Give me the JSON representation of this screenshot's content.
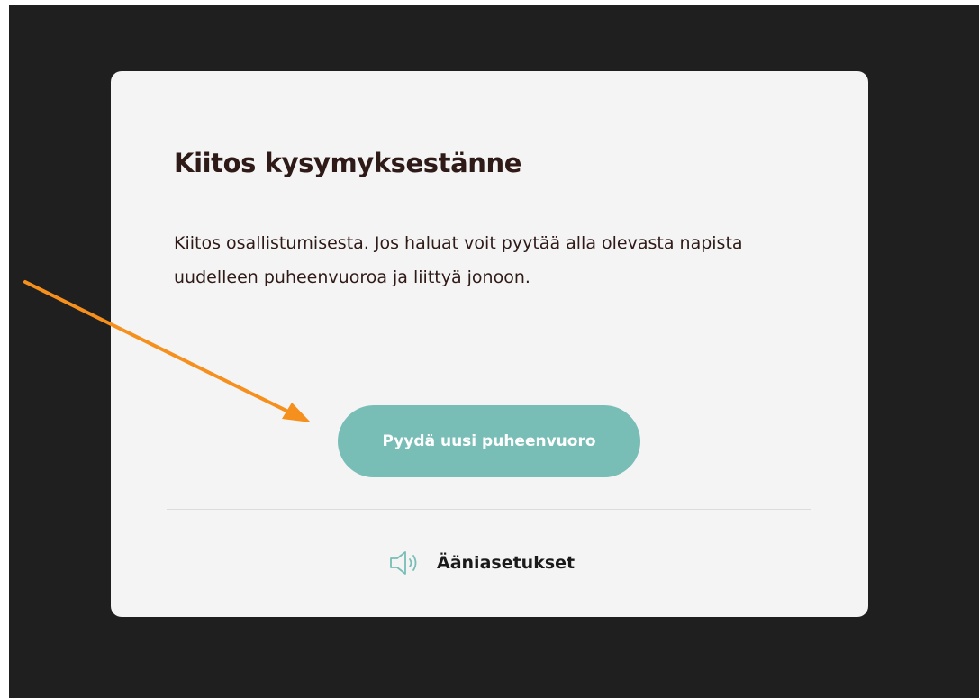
{
  "dialog": {
    "title": "Kiitos kysymyksestänne",
    "body": "Kiitos osallistumisesta. Jos haluat voit pyytää alla olevasta napista uudelleen puheenvuoroa ja liittyä jonoon.",
    "request_button_label": "Pyydä uusi puheenvuoro",
    "audio_settings_label": "Ääniasetukset",
    "audio_icon": "speaker-icon"
  },
  "colors": {
    "background": "#1f1f1f",
    "card": "#f4f4f4",
    "title_text": "#2e1a17",
    "button": "#78bdb6",
    "button_text": "#ffffff",
    "icon": "#78bdb6",
    "annotation_arrow": "#f5901e"
  }
}
